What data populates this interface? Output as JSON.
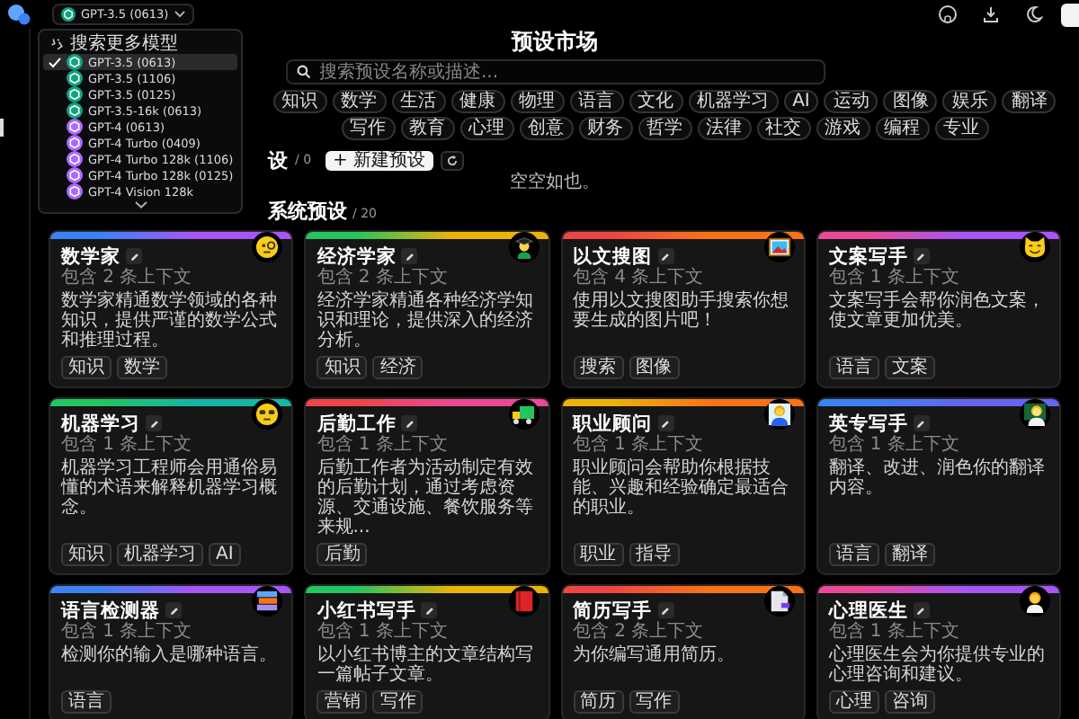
{
  "model_selector": {
    "label": "GPT-3.5 (0613)",
    "color": "#10a37f"
  },
  "model_menu": {
    "search_label": "搜索更多模型",
    "items": [
      {
        "label": "GPT-3.5 (0613)",
        "selected": true,
        "color": "#10a37f"
      },
      {
        "label": "GPT-3.5 (1106)",
        "selected": false,
        "color": "#10a37f"
      },
      {
        "label": "GPT-3.5 (0125)",
        "selected": false,
        "color": "#10a37f"
      },
      {
        "label": "GPT-3.5-16k (0613)",
        "selected": false,
        "color": "#10a37f"
      },
      {
        "label": "GPT-4 (0613)",
        "selected": false,
        "color": "#ab68ff"
      },
      {
        "label": "GPT-4 Turbo (0409)",
        "selected": false,
        "color": "#ab68ff"
      },
      {
        "label": "GPT-4 Turbo 128k (1106)",
        "selected": false,
        "color": "#ab68ff"
      },
      {
        "label": "GPT-4 Turbo 128k (0125)",
        "selected": false,
        "color": "#ab68ff"
      },
      {
        "label": "GPT-4 Vision 128k",
        "selected": false,
        "color": "#ab68ff"
      }
    ]
  },
  "title": "预设市场",
  "search": {
    "placeholder": "搜索预设名称或描述..."
  },
  "tags": [
    "知识",
    "数学",
    "生活",
    "健康",
    "物理",
    "语言",
    "文化",
    "机器学习",
    "AI",
    "运动",
    "图像",
    "娱乐",
    "翻译",
    "写作",
    "教育",
    "心理",
    "创意",
    "财务",
    "哲学",
    "法律",
    "社交",
    "游戏",
    "编程",
    "专业"
  ],
  "my_presets": {
    "title": "设",
    "count": "/ 0",
    "new_button": "+ 新建预设",
    "empty_text": "空空如也。"
  },
  "system_presets": {
    "title": "系统预设",
    "count": "/ 20"
  },
  "cards": [
    {
      "title": "数学家",
      "context": "包含 2 条上下文",
      "description": "数学家精通数学领域的各种知识，提供严谨的数学公式和推理过程。",
      "tags": [
        "知识",
        "数学"
      ],
      "accent": [
        {
          "color": "#3b82f6"
        },
        {
          "color": "#a855f7"
        }
      ]
    },
    {
      "title": "经济学家",
      "context": "包含 2 条上下文",
      "description": "经济学家精通各种经济学知识和理论，提供深入的经济分析。",
      "tags": [
        "知识",
        "经济"
      ],
      "accent": [
        {
          "color": "#22c55e"
        },
        {
          "color": "#eab308"
        }
      ]
    },
    {
      "title": "以文搜图",
      "context": "包含 4 条上下文",
      "description": "使用以文搜图助手搜索你想要生成的图片吧！",
      "tags": [
        "搜索",
        "图像"
      ],
      "accent": [
        {
          "color": "#ef4444"
        },
        {
          "color": "#f97316"
        }
      ]
    },
    {
      "title": "文案写手",
      "context": "包含 1 条上下文",
      "description": "文案写手会帮你润色文案，使文章更加优美。",
      "tags": [
        "语言",
        "文案"
      ],
      "accent": [
        {
          "color": "#ec4899"
        },
        {
          "color": "#a855f7"
        }
      ]
    },
    {
      "title": "机器学习",
      "context": "包含 1 条上下文",
      "description": "机器学习工程师会用通俗易懂的术语来解释机器学习概念。",
      "tags": [
        "知识",
        "机器学习",
        "AI"
      ],
      "accent": [
        {
          "color": "#22c55e"
        },
        {
          "color": "#14b8a6"
        }
      ]
    },
    {
      "title": "后勤工作",
      "context": "包含 1 条上下文",
      "description": "后勤工作者为活动制定有效的后勤计划，通过考虑资源、交通设施、餐饮服务等来规...",
      "tags": [
        "后勤"
      ],
      "accent": [
        {
          "color": "#ef4444"
        },
        {
          "color": "#ec4899"
        }
      ]
    },
    {
      "title": "职业顾问",
      "context": "包含 1 条上下文",
      "description": "职业顾问会帮助你根据技能、兴趣和经验确定最适合的职业。",
      "tags": [
        "职业",
        "指导"
      ],
      "accent": [
        {
          "color": "#eab308"
        },
        {
          "color": "#f97316"
        }
      ]
    },
    {
      "title": "英专写手",
      "context": "包含 1 条上下文",
      "description": "翻译、改进、润色你的翻译内容。",
      "tags": [
        "语言",
        "翻译"
      ],
      "accent": [
        {
          "color": "#3b82f6"
        },
        {
          "color": "#6366f1"
        }
      ]
    },
    {
      "title": "语言检测器",
      "context": "包含 1 条上下文",
      "description": "检测你的输入是哪种语言。",
      "tags": [
        "语言"
      ],
      "accent": [
        {
          "color": "#3b82f6"
        },
        {
          "color": "#a855f7"
        }
      ]
    },
    {
      "title": "小红书写手",
      "context": "包含 1 条上下文",
      "description": "以小红书博主的文章结构写一篇帖子文章。",
      "tags": [
        "营销",
        "写作"
      ],
      "accent": [
        {
          "color": "#22c55e"
        },
        {
          "color": "#eab308"
        }
      ]
    },
    {
      "title": "简历写手",
      "context": "包含 2 条上下文",
      "description": "为你编写通用简历。",
      "tags": [
        "简历",
        "写作"
      ],
      "accent": [
        {
          "color": "#ef4444"
        },
        {
          "color": "#f97316"
        }
      ]
    },
    {
      "title": "心理医生",
      "context": "包含 1 条上下文",
      "description": "心理医生会为你提供专业的心理咨询和建议。",
      "tags": [
        "心理",
        "咨询"
      ],
      "accent": [
        {
          "color": "#ec4899"
        },
        {
          "color": "#a855f7"
        }
      ]
    }
  ]
}
